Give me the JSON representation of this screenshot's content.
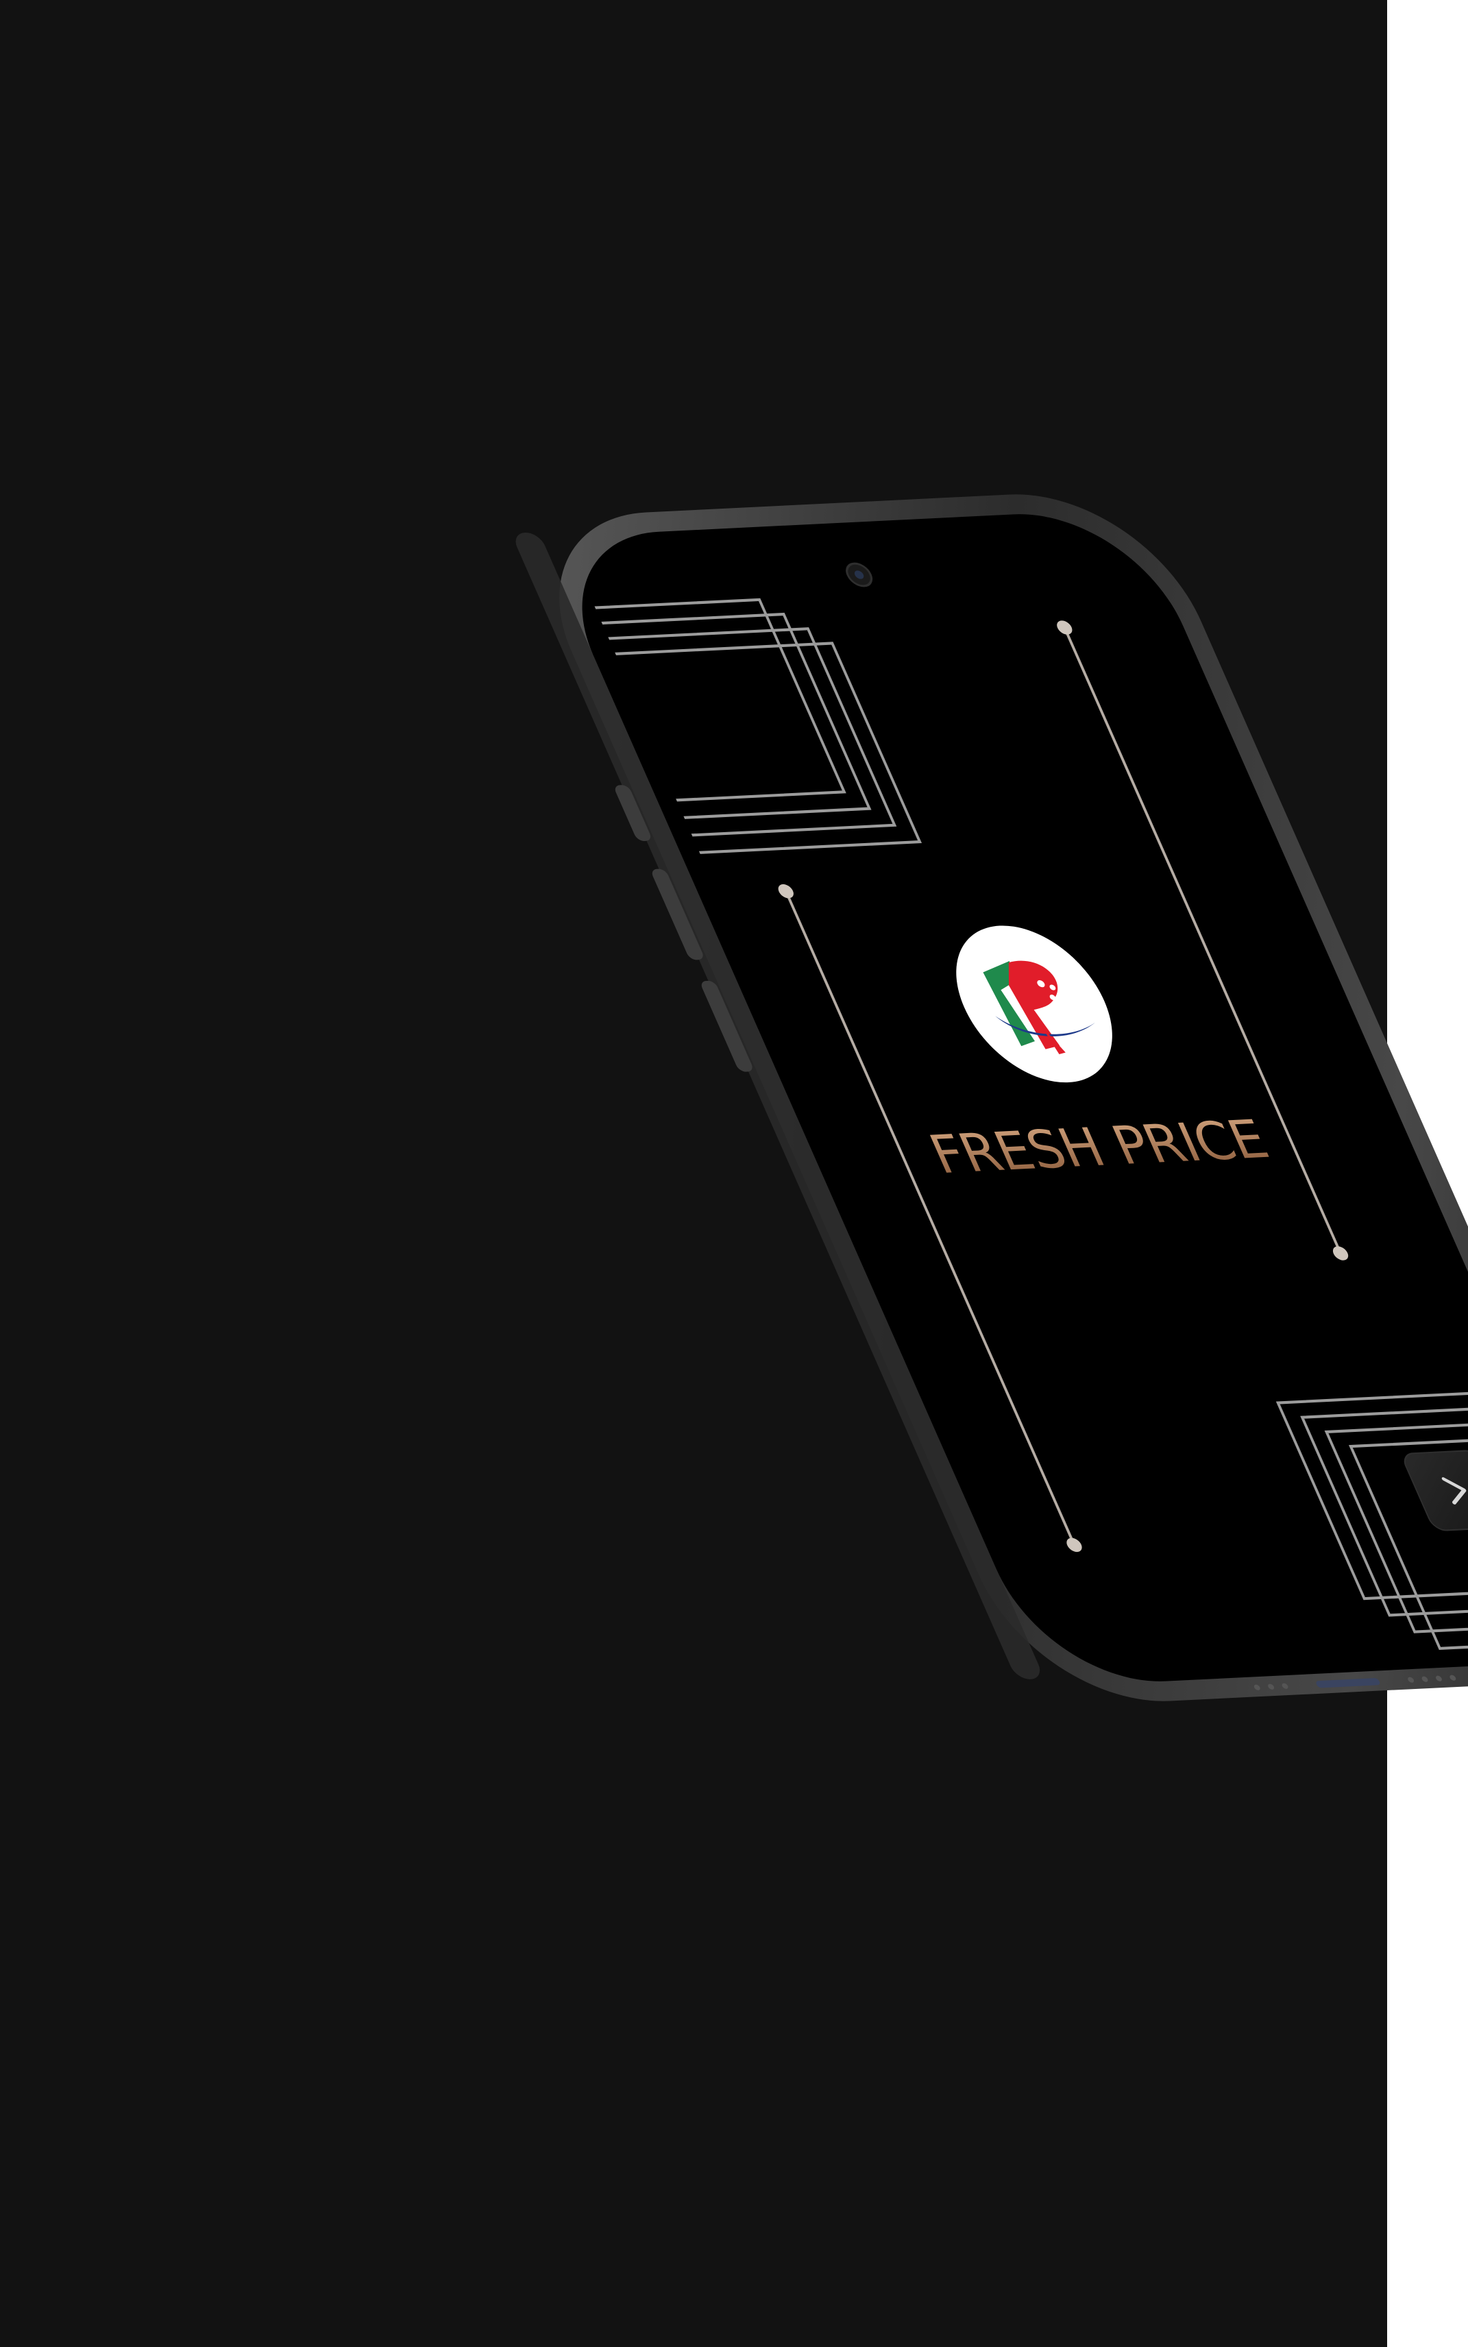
{
  "app": {
    "brand_name": "FRESH PRICE",
    "logo_icon": "fresh-price-logo-icon",
    "next_icon": "chevron-right-icon"
  },
  "colors": {
    "backdrop": "#121212",
    "screen": "#000000",
    "frame": "#3a3a3a",
    "brand_text_top": "#c89a76",
    "brand_text_bottom": "#8a5a3a",
    "line_accent": "#bfb4ab",
    "logo_red": "#e11d2a",
    "logo_green": "#1f8a4c",
    "logo_blue": "#1e3a8a"
  }
}
